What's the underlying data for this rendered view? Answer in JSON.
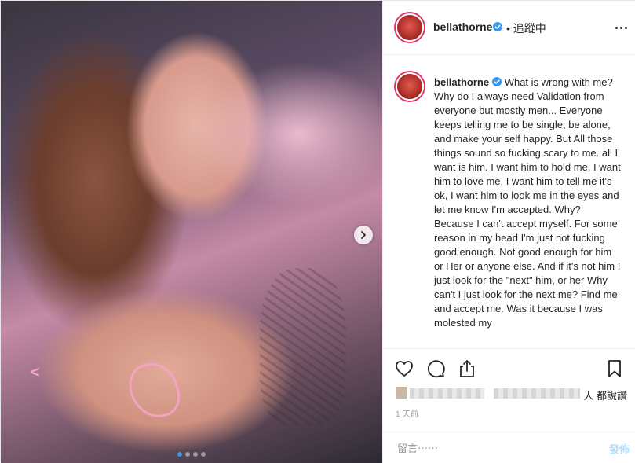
{
  "post": {
    "username": "bellathorne",
    "follow_status": "• 追蹤中",
    "caption_username": "bellathorne",
    "caption_text": "What is wrong with me? Why do I always need Validation from everyone but mostly men... Everyone keeps telling me to be single, be alone, and make your self happy. But All those things sound so fucking scary to me. all I want is him. I want him to hold me, I want him to love me, I want him to tell me it's ok, I want him to look me in the eyes and let me know I'm accepted. Why? Because I can't accept myself. For some reason in my head I'm just not fucking good enough. Not good enough for him or Her or anyone else. And if it's not him I just look for the \"next\" him, or her Why can't I just look for the next me? Find me and accept me. Was it because I was molested my",
    "likes_suffix": "人 都說讚",
    "timestamp": "1 天前",
    "comment_placeholder": "留言⋯⋯",
    "post_button": "發佈"
  },
  "carousel": {
    "slides": 4,
    "active_index": 0
  },
  "icons": {
    "header": [
      "avatar",
      "verified-badge-icon",
      "more-options-icon"
    ],
    "actions": [
      "heart-icon",
      "comment-icon",
      "share-icon",
      "bookmark-icon"
    ],
    "media": [
      "chevron-right-icon"
    ]
  },
  "colors": {
    "verified": "#3897f0",
    "active_dot": "#3897f0",
    "post_button_disabled": "#b2dffc",
    "timestamp": "#999999",
    "text": "#262626"
  }
}
